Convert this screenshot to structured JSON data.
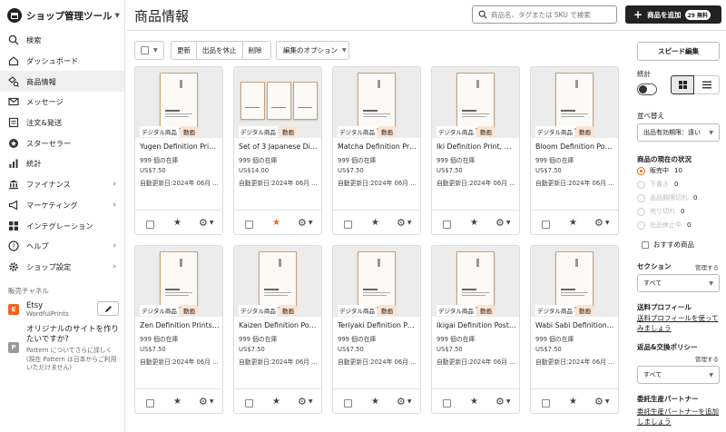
{
  "sidebar": {
    "brand": "ショップ管理ツール",
    "items": [
      {
        "label": "検索",
        "icon": "search-icon"
      },
      {
        "label": "ダッシュボード",
        "icon": "home-icon"
      },
      {
        "label": "商品情報",
        "icon": "listings-icon",
        "active": true
      },
      {
        "label": "メッセージ",
        "icon": "mail-icon"
      },
      {
        "label": "注文&発送",
        "icon": "orders-icon"
      },
      {
        "label": "スターセラー",
        "icon": "star-seller-icon"
      },
      {
        "label": "統計",
        "icon": "stats-icon"
      },
      {
        "label": "ファイナンス",
        "icon": "bank-icon",
        "chevron": true
      },
      {
        "label": "マーケティング",
        "icon": "megaphone-icon",
        "chevron": true
      },
      {
        "label": "インテグレーション",
        "icon": "integrations-icon"
      },
      {
        "label": "ヘルプ",
        "icon": "help-icon",
        "chevron": true
      },
      {
        "label": "ショップ設定",
        "icon": "gear-icon",
        "chevron": true
      }
    ],
    "channels_label": "販売チャネル",
    "etsy": {
      "logo": "E",
      "name": "Etsy",
      "shop": "WordfulPrints"
    },
    "pattern": {
      "logo": "P",
      "title": "オリジナルのサイトを作りたいですか?",
      "desc": "Pattern についてさらに詳しく (現在 Pattern は日本からご利用いただけません)"
    }
  },
  "header": {
    "title": "商品情報",
    "search_placeholder": "商品名、タグまたは SKU で検索",
    "add_label": "商品を追加",
    "add_badge": "29 無料"
  },
  "toolbar": {
    "renew": "更新",
    "deactivate": "出品を休止",
    "delete": "削除",
    "options": "編集のオプション"
  },
  "card_common": {
    "digital": "デジタル商品",
    "video": "動画"
  },
  "cards": [
    {
      "title": "Yugen Definition Print, ...",
      "stock": "999 個の在庫",
      "price": "US$7.50",
      "renew": "自動更新日:2024年 06月 1...",
      "thumb": "single",
      "featured": false
    },
    {
      "title": "Set of 3 Japanese Dicti...",
      "stock": "999 個の在庫",
      "price": "US$14.00",
      "renew": "自動更新日:2024年 06月 1...",
      "thumb": "set",
      "featured": true
    },
    {
      "title": "Matcha Definition Print ...",
      "stock": "999 個の在庫",
      "price": "US$7.50",
      "renew": "自動更新日:2024年 06月 1...",
      "thumb": "single",
      "featured": false
    },
    {
      "title": "Iki Definition Print, Dic...",
      "stock": "999 個の在庫",
      "price": "US$7.50",
      "renew": "自動更新日:2024年 06月 1...",
      "thumb": "single",
      "featured": false
    },
    {
      "title": "Bloom Definition Poste...",
      "stock": "999 個の在庫",
      "price": "US$7.50",
      "renew": "自動更新日:2024年 06月 1...",
      "thumb": "single",
      "featured": false
    },
    {
      "title": "Zen Definition Prints, Z...",
      "stock": "999 個の在庫",
      "price": "US$7.50",
      "renew": "自動更新日:2024年 06月 1...",
      "thumb": "single",
      "featured": false
    },
    {
      "title": "Kaizen Definition Poste...",
      "stock": "999 個の在庫",
      "price": "US$7.50",
      "renew": "自動更新日:2024年 06月 7...",
      "thumb": "single",
      "featured": false
    },
    {
      "title": "Teriyaki Definition Post...",
      "stock": "999 個の在庫",
      "price": "US$7.50",
      "renew": "自動更新日:2024年 06月 7...",
      "thumb": "single",
      "featured": false
    },
    {
      "title": "Ikigai Definition Poster...",
      "stock": "999 個の在庫",
      "price": "US$7.50",
      "renew": "自動更新日:2024年 06月 7...",
      "thumb": "single",
      "featured": false
    },
    {
      "title": "Wabi Sabi Definition P...",
      "stock": "999 個の在庫",
      "price": "US$7.50",
      "renew": "自動更新日:2024年 06月 5...",
      "thumb": "single",
      "featured": false
    }
  ],
  "right_panel": {
    "speed_edit": "スピード編集",
    "stats_label": "統計",
    "sort_label": "並べ替え",
    "sort_value": "出品有効期限：遠い",
    "status_label": "商品の現在の状況",
    "statuses": [
      {
        "label": "販売中",
        "count": "10",
        "on": true
      },
      {
        "label": "下書き",
        "count": "0"
      },
      {
        "label": "出品期限切れ",
        "count": "0"
      },
      {
        "label": "売り切れ",
        "count": "0"
      },
      {
        "label": "出品休止中",
        "count": "0"
      }
    ],
    "featured_label": "おすすめ商品",
    "section_label": "セクション",
    "manage": "管理する",
    "section_value": "すべて",
    "shipping_label": "送料プロフィール",
    "shipping_link": "送料プロフィールを使ってみましょう",
    "returns_label": "返品&交換ポリシー",
    "returns_manage": "管理する",
    "returns_value": "すべて",
    "partner_label": "委託生産パートナー",
    "partner_link": "委託生産パートナーを追加しましょう"
  }
}
